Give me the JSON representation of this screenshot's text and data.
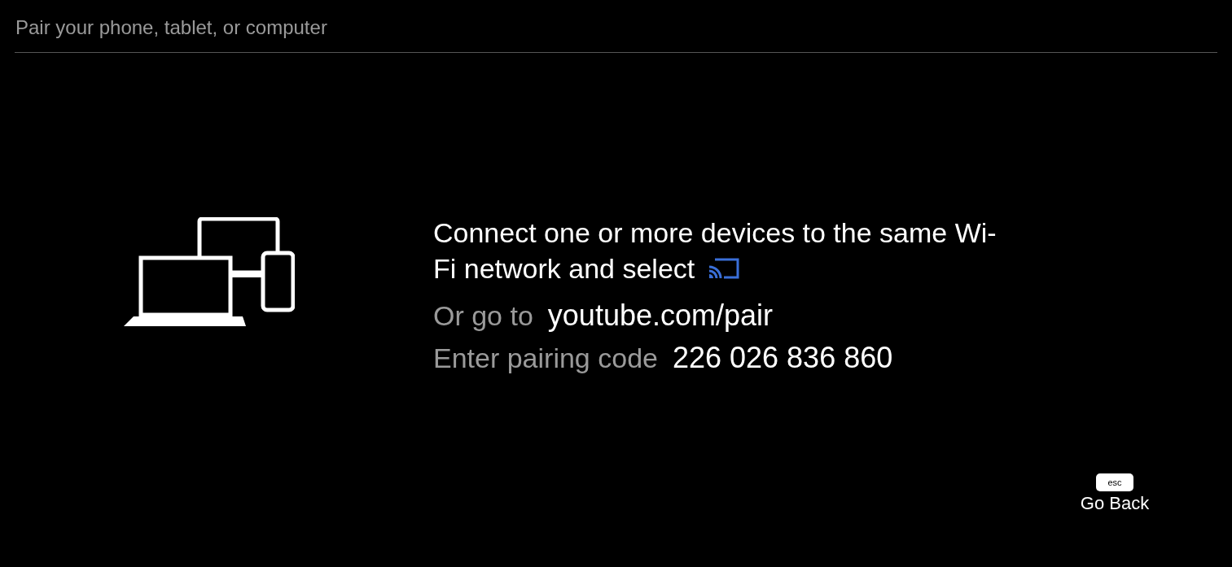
{
  "header": {
    "title": "Pair your phone, tablet, or computer"
  },
  "instructions": {
    "lines": [
      "Connect one or more devices to the same Wi-",
      "Fi network and select"
    ]
  },
  "links": [
    {
      "label": "Or go to",
      "value": "youtube.com/pair"
    },
    {
      "label": "Enter pairing code",
      "value": "226 026 836 860"
    }
  ],
  "back": {
    "key": "esc",
    "label": "Go Back"
  }
}
